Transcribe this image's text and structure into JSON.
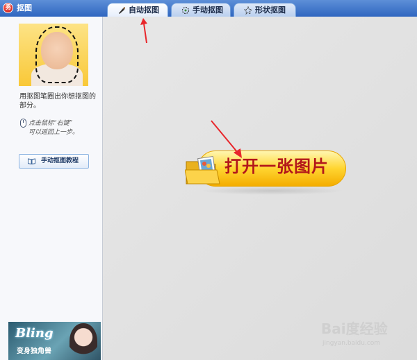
{
  "window": {
    "title": "抠图",
    "logo_text": "秀"
  },
  "tabs": [
    {
      "label": "自动抠图",
      "icon": "brush-icon",
      "active": true
    },
    {
      "label": "手动抠图",
      "icon": "lasso-icon",
      "active": false
    },
    {
      "label": "形状抠图",
      "icon": "shape-icon",
      "active": false
    }
  ],
  "sidebar": {
    "description": "用抠图笔圈出你想抠图的部分。",
    "hint_line1": "点击鼠标“右键”",
    "hint_line2": "可以返回上一步。",
    "tutorial_button": "手动抠图教程",
    "ad": {
      "title": "Bling",
      "subtitle": "变身独角兽"
    }
  },
  "canvas": {
    "open_button": "打开一张图片"
  },
  "watermark": {
    "logo": "Bai度经验",
    "url": "jingyan.baidu.com"
  },
  "colors": {
    "titlebar": "#2f66c0",
    "accent_yellow": "#ffd530",
    "button_text_red": "#b3171a",
    "annotation_arrow": "#e8262b"
  }
}
